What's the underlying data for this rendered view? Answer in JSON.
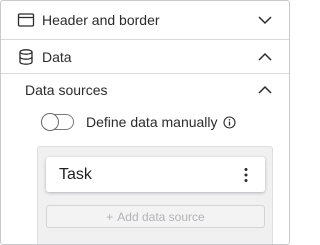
{
  "sections": {
    "header_border": {
      "title": "Header and border",
      "icon": "window-icon",
      "state": "collapsed"
    },
    "data": {
      "title": "Data",
      "icon": "database-icon",
      "state": "expanded"
    }
  },
  "data_sources": {
    "title": "Data sources",
    "state": "expanded",
    "toggle": {
      "label": "Define data manually",
      "checked": false
    },
    "items": [
      {
        "label": "Task"
      }
    ],
    "add_button": {
      "plus": "+",
      "label": "Add data source",
      "enabled": false
    }
  },
  "colors": {
    "border": "#c9c9cc",
    "divider": "#d9d9dc",
    "source_bg": "#f0f0f1",
    "disabled_text": "#b3b3b6"
  }
}
